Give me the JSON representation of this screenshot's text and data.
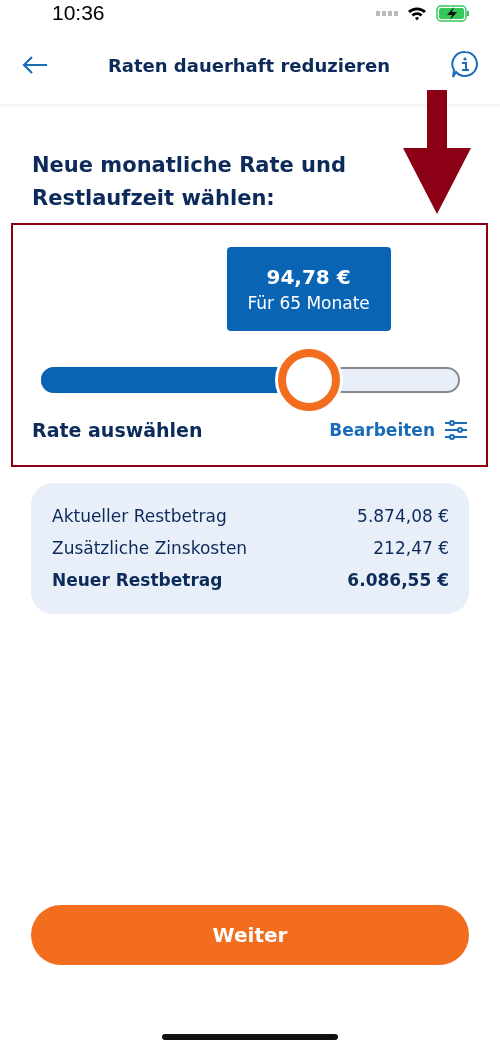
{
  "status_bar": {
    "time": "10:36"
  },
  "header": {
    "title": "Raten dauerhaft reduzieren"
  },
  "heading": "Neue monatliche Rate und Restlaufzeit wählen:",
  "slider": {
    "amount": "94,78 €",
    "duration": "Für 65 Monate",
    "level": 0.64,
    "label": "Rate auswählen",
    "edit_link": "Bearbeiten"
  },
  "summary": [
    {
      "label": "Aktueller Restbetrag",
      "value": "5.874,08 €",
      "kind": "item"
    },
    {
      "label": "Zusätzliche Zinskosten",
      "value": "212,47 €",
      "kind": "item"
    },
    {
      "label": "Neuer Restbetrag",
      "value": "6.086,55 €",
      "kind": "total"
    }
  ],
  "primary_button": "Weiter"
}
